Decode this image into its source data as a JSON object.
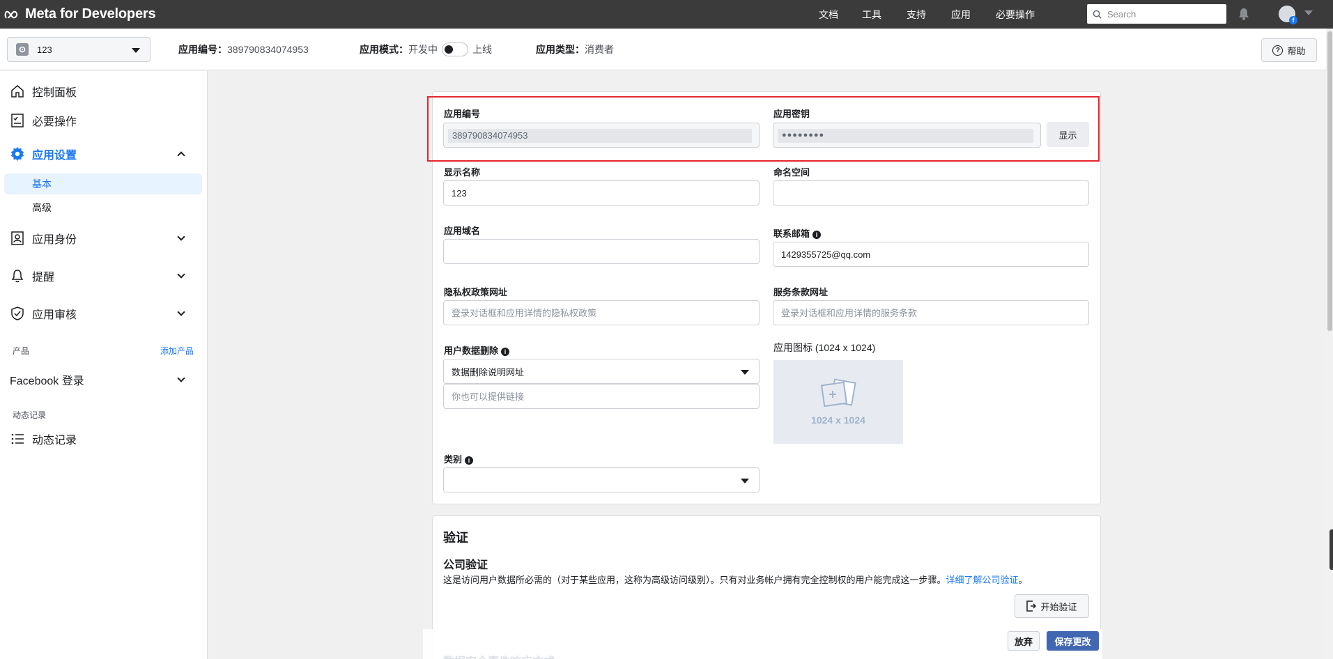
{
  "topnav": {
    "logo": "Meta for Developers",
    "links": [
      "文档",
      "工具",
      "支持",
      "应用",
      "必要操作"
    ],
    "search_placeholder": "Search"
  },
  "subheader": {
    "app_name": "123",
    "app_id_label": "应用编号：",
    "app_id_value": "389790834074953",
    "mode_label": "应用模式：",
    "mode_dev": "开发中",
    "mode_live": "上线",
    "type_label": "应用类型：",
    "type_value": "消费者",
    "help": "帮助"
  },
  "sidebar": {
    "items": [
      {
        "label": "控制面板"
      },
      {
        "label": "必要操作"
      },
      {
        "label": "应用设置"
      },
      {
        "label": "应用身份"
      },
      {
        "label": "提醒"
      },
      {
        "label": "应用审核"
      }
    ],
    "sub_items": [
      "基本",
      "高级"
    ],
    "products_label": "产品",
    "add_product": "添加产品",
    "facebook_login": "Facebook 登录",
    "activity_section": "动态记录",
    "activity_item": "动态记录"
  },
  "form": {
    "app_id_label": "应用编号",
    "app_id_value": "389790834074953",
    "app_secret_label": "应用密钥",
    "app_secret_value": "●●●●●●●●",
    "show_button": "显示",
    "display_name_label": "显示名称",
    "display_name_value": "123",
    "namespace_label": "命名空间",
    "namespace_value": "",
    "app_domain_label": "应用域名",
    "app_domain_value": "",
    "contact_email_label": "联系邮箱",
    "contact_email_value": "1429355725@qq.com",
    "privacy_label": "隐私权政策网址",
    "privacy_placeholder": "登录对话框和应用详情的隐私权政策",
    "tos_label": "服务条款网址",
    "tos_placeholder": "登录对话框和应用详情的服务条款",
    "deletion_label": "用户数据删除",
    "deletion_select": "数据删除说明网址",
    "deletion_placeholder": "你也可以提供链接",
    "icon_label": "应用图标 (1024 x 1024)",
    "icon_size": "1024 x 1024",
    "category_label": "类别",
    "category_value": ""
  },
  "verification": {
    "title": "验证",
    "subtitle": "公司验证",
    "desc": "这是访问用户数据所必需的（对于某些应用，这称为高级访问级别）。只有对业务帐户拥有完全控制权的用户能完成这一步骤。",
    "link": "详细了解公司验证",
    "period": "。",
    "start_button": "开始验证",
    "faded_next": "数据安全事件响应方式"
  },
  "actions": {
    "discard": "放弃",
    "save": "保存更改"
  },
  "colors": {
    "accent": "#1877f2",
    "save": "#4267b2",
    "highlight": "#e4252c"
  }
}
